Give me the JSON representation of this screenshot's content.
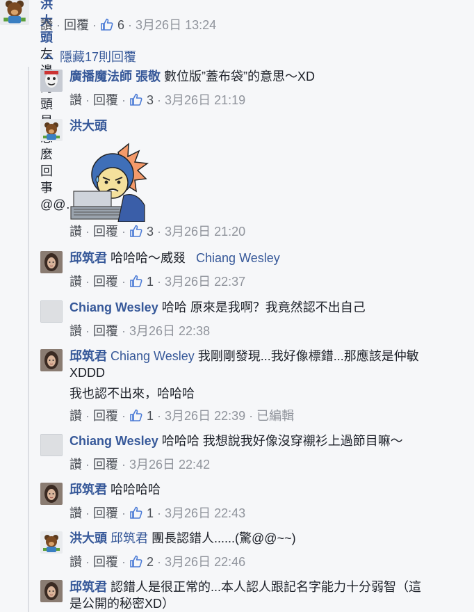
{
  "top_comment": {
    "author": "洪大頭",
    "text": "左邊的頭是怎麼回事@@………",
    "like_label": "讚",
    "reply_label": "回覆",
    "likes": "6",
    "time": "3月26日 13:24"
  },
  "toggle_replies": "隱藏17則回覆",
  "replies": [
    {
      "author": "廣播魔法師 張敬",
      "text": "數位版”蓋布袋”的意思～XD",
      "likes": "3",
      "time": "3月26日 21:19",
      "like_label": "讚",
      "reply_label": "回覆"
    },
    {
      "author": "洪大頭",
      "text": "",
      "likes": "3",
      "time": "3月26日 21:20",
      "like_label": "讚",
      "reply_label": "回覆"
    },
    {
      "author": "邱筑君",
      "text": "哈哈哈～威叕",
      "tag": "Chiang Wesley",
      "likes": "1",
      "time": "3月26日 22:37",
      "like_label": "讚",
      "reply_label": "回覆"
    },
    {
      "author": "Chiang Wesley",
      "text": "哈哈 原來是我啊？我竟然認不出自己",
      "likes": "",
      "time": "3月26日 22:38",
      "like_label": "讚",
      "reply_label": "回覆"
    },
    {
      "author": "邱筑君",
      "tag": "Chiang Wesley",
      "text": "我剛剛發現...我好像標錯...那應該是仲敏",
      "text2": "XDDD",
      "text3": "我也認不出來，哈哈哈",
      "likes": "1",
      "time": "3月26日 22:39",
      "edited": "已編輯",
      "like_label": "讚",
      "reply_label": "回覆"
    },
    {
      "author": "Chiang Wesley",
      "text": "哈哈哈 我想說我好像沒穿襯衫上過節目嘛～",
      "likes": "",
      "time": "3月26日 22:42",
      "like_label": "讚",
      "reply_label": "回覆"
    },
    {
      "author": "邱筑君",
      "text": "哈哈哈哈",
      "likes": "1",
      "time": "3月26日 22:43",
      "like_label": "讚",
      "reply_label": "回覆"
    },
    {
      "author": "洪大頭",
      "tag": "邱筑君",
      "text": "團長認錯人......(驚@@~~)",
      "likes": "2",
      "time": "3月26日 22:46",
      "like_label": "讚",
      "reply_label": "回覆"
    },
    {
      "author": "邱筑君",
      "text": "認錯人是很正常的...本人認人跟記名字能力十分弱智（這",
      "text2": "是公開的秘密XD）"
    }
  ],
  "colors": {
    "link": "#365899",
    "meta": "#90949c",
    "rail": "#dcdee3",
    "background": "#f6f7f9"
  }
}
